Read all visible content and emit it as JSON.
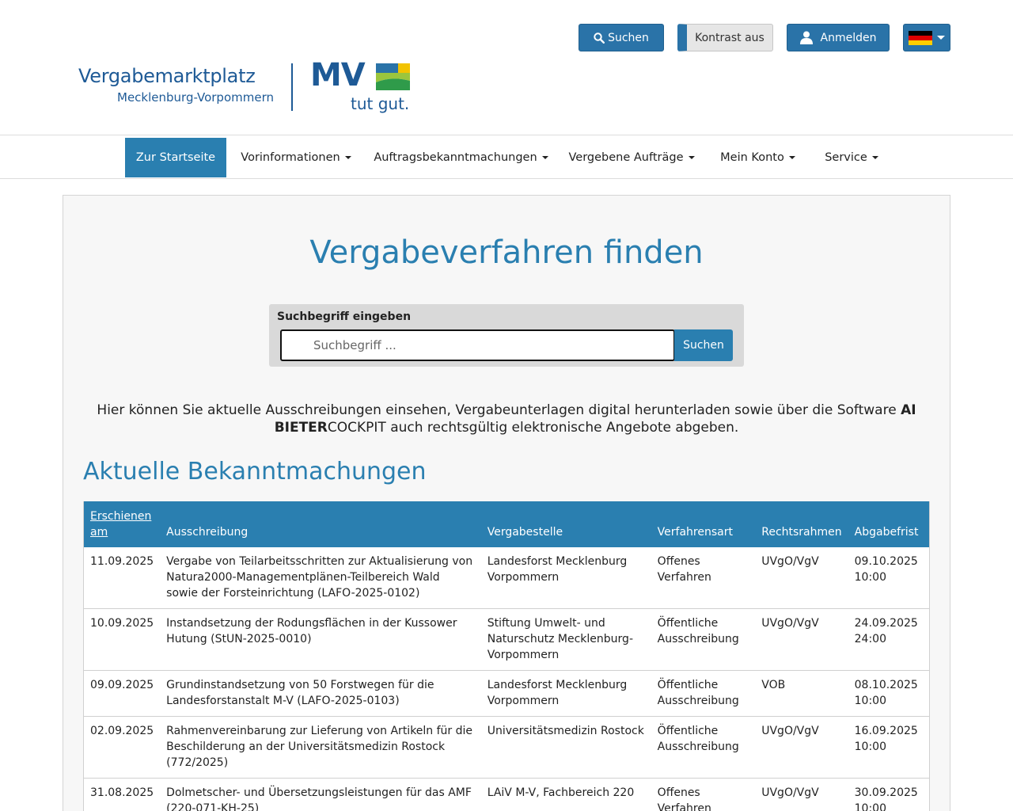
{
  "header": {
    "search_button": "Suchen",
    "contrast_button": "Kontrast aus",
    "login_button": "Anmelden",
    "language_selector": "de-flag-icon",
    "logo_title": "Vergabemarktplatz",
    "logo_subtitle": "Mecklenburg-Vorpommern",
    "brand_mv": "MV",
    "brand_slogan": "tut gut."
  },
  "nav": {
    "items": [
      {
        "label": "Zur Startseite"
      },
      {
        "label": "Vorinformationen"
      },
      {
        "label": "Auftragsbekanntmachungen"
      },
      {
        "label": "Vergebene Aufträge"
      },
      {
        "label": "Mein Konto"
      },
      {
        "label": "Service"
      }
    ]
  },
  "main": {
    "title": "Vergabeverfahren finden",
    "search_label": "Suchbegriff eingeben",
    "search_placeholder": "Suchbegriff ...",
    "search_submit": "Suchen",
    "intro_part1": "Hier können Sie aktuelle Ausschreibungen einsehen, Vergabeunterlagen digital herunterladen sowie über die Software ",
    "intro_bold": "AI BIETER",
    "intro_part2": "COCKPIT auch rechtsgültig elektronische Angebote abgeben.",
    "section_title": "Aktuelle Bekanntmachungen"
  },
  "table": {
    "headers": [
      "Erschienen am",
      "Ausschreibung",
      "Vergabestelle",
      "Verfahrensart",
      "Rechtsrahmen",
      "Abgabefrist"
    ],
    "rows": [
      {
        "date": "11.09.2025",
        "title": "Vergabe von Teilarbeitsschritten zur Aktualisierung von Natura2000-Managementplänen-Teilbereich Wald sowie der Forsteinrichtung (LAFO-2025-0102)",
        "authority": "Landesforst Mecklenburg Vorpommern",
        "procedure": "Offenes Verfahren",
        "framework": "UVgO/VgV",
        "deadline_date": "09.10.2025",
        "deadline_time": "10:00"
      },
      {
        "date": "10.09.2025",
        "title": "Instandsetzung der Rodungsflächen in der Kussower Hutung (StUN-2025-0010)",
        "authority": "Stiftung Umwelt- und Naturschutz Mecklenburg-Vorpommern",
        "procedure": "Öffentliche Ausschreibung",
        "framework": "UVgO/VgV",
        "deadline_date": "24.09.2025",
        "deadline_time": "24:00"
      },
      {
        "date": "09.09.2025",
        "title": "Grundinstandsetzung von 50 Forstwegen für die Landesforstanstalt M-V (LAFO-2025-0103)",
        "authority": "Landesforst Mecklenburg Vorpommern",
        "procedure": "Öffentliche Ausschreibung",
        "framework": "VOB",
        "deadline_date": "08.10.2025",
        "deadline_time": "10:00"
      },
      {
        "date": "02.09.2025",
        "title": "Rahmenvereinbarung zur Lieferung von Artikeln für die Beschilderung an der Universitätsmedizin Rostock (772/2025)",
        "authority": "Universitätsmedizin Rostock",
        "procedure": "Öffentliche Ausschreibung",
        "framework": "UVgO/VgV",
        "deadline_date": "16.09.2025",
        "deadline_time": "10:00"
      },
      {
        "date": "31.08.2025",
        "title": "Dolmetscher- und Übersetzungsleistungen für das AMF (220-071-KH-25)",
        "authority": "LAiV M-V, Fachbereich 220",
        "procedure": "Offenes Verfahren",
        "framework": "UVgO/VgV",
        "deadline_date": "30.09.2025",
        "deadline_time": "10:00"
      }
    ]
  },
  "colors": {
    "primary": "#2a7fb0",
    "button_blue": "#2a73a8",
    "brand_blue": "#1e5a96"
  }
}
